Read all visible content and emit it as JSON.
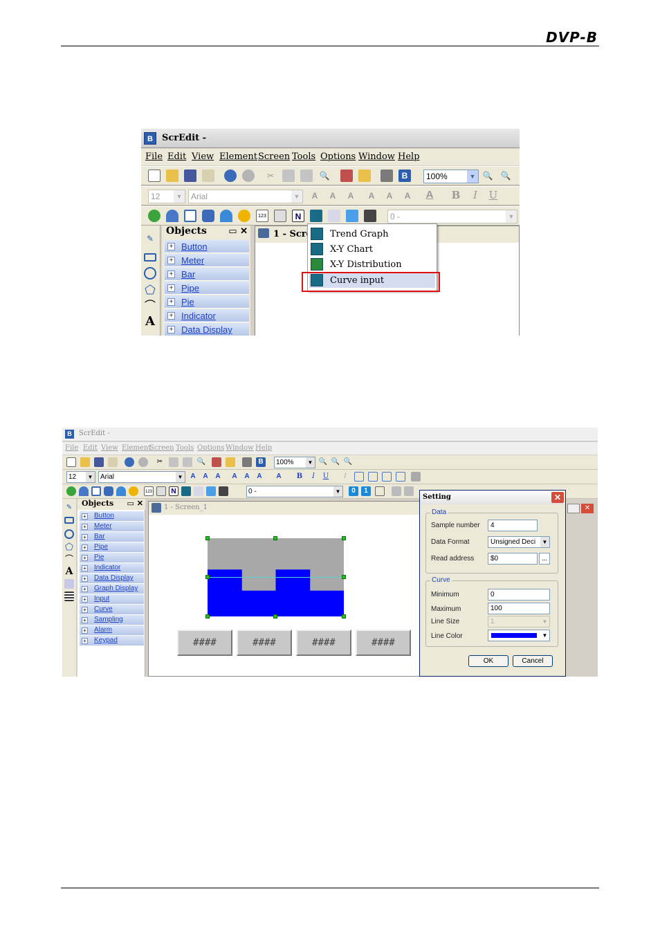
{
  "header": {
    "logo": "DVP-B"
  },
  "shot1": {
    "app_title": "ScrEdit -",
    "menu": [
      "File",
      "Edit",
      "View",
      "Element",
      "Screen",
      "Tools",
      "Options",
      "Window",
      "Help"
    ],
    "zoom": "100%",
    "font_size": "12",
    "font_name": "Arial",
    "object_combo": "0 -",
    "objects_title": "Objects",
    "objects": [
      "Button",
      "Meter",
      "Bar",
      "Pipe",
      "Pie",
      "Indicator",
      "Data Display"
    ],
    "screen_title": "1 - Scre",
    "popup": [
      "Trend Graph",
      "X-Y Chart",
      "X-Y Distribution",
      "Curve input"
    ]
  },
  "shot2": {
    "app_title": "ScrEdit -",
    "menu": [
      "File",
      "Edit",
      "View",
      "Element",
      "Screen",
      "Tools",
      "Options",
      "Window",
      "Help"
    ],
    "zoom": "100%",
    "font_size": "12",
    "font_name": "Arial",
    "object_combo": "0 -",
    "objects_title": "Objects",
    "objects": [
      "Button",
      "Meter",
      "Bar",
      "Pipe",
      "Pie",
      "Indicator",
      "Data Display",
      "Graph Display",
      "Input",
      "Curve",
      "Sampling",
      "Alarm",
      "Keypad"
    ],
    "screen_title": "1 - Screen_1",
    "hash_buttons": [
      "####",
      "####",
      "####",
      "####"
    ],
    "curve_levels": [
      0.6,
      0.33,
      0.6,
      0.33
    ],
    "dialog": {
      "title": "Setting",
      "data_group": "Data",
      "sample_number_label": "Sample number",
      "sample_number": "4",
      "data_format_label": "Data Format",
      "data_format": "Unsigned Deci",
      "read_address_label": "Read address",
      "read_address": "$0",
      "browse": "...",
      "curve_group": "Curve",
      "minimum_label": "Minimum",
      "minimum": "0",
      "maximum_label": "Maximum",
      "maximum": "100",
      "line_size_label": "Line Size",
      "line_size": "1",
      "line_color_label": "Line Color",
      "line_color": "#0000ff",
      "ok": "OK",
      "cancel": "Cancel"
    }
  }
}
